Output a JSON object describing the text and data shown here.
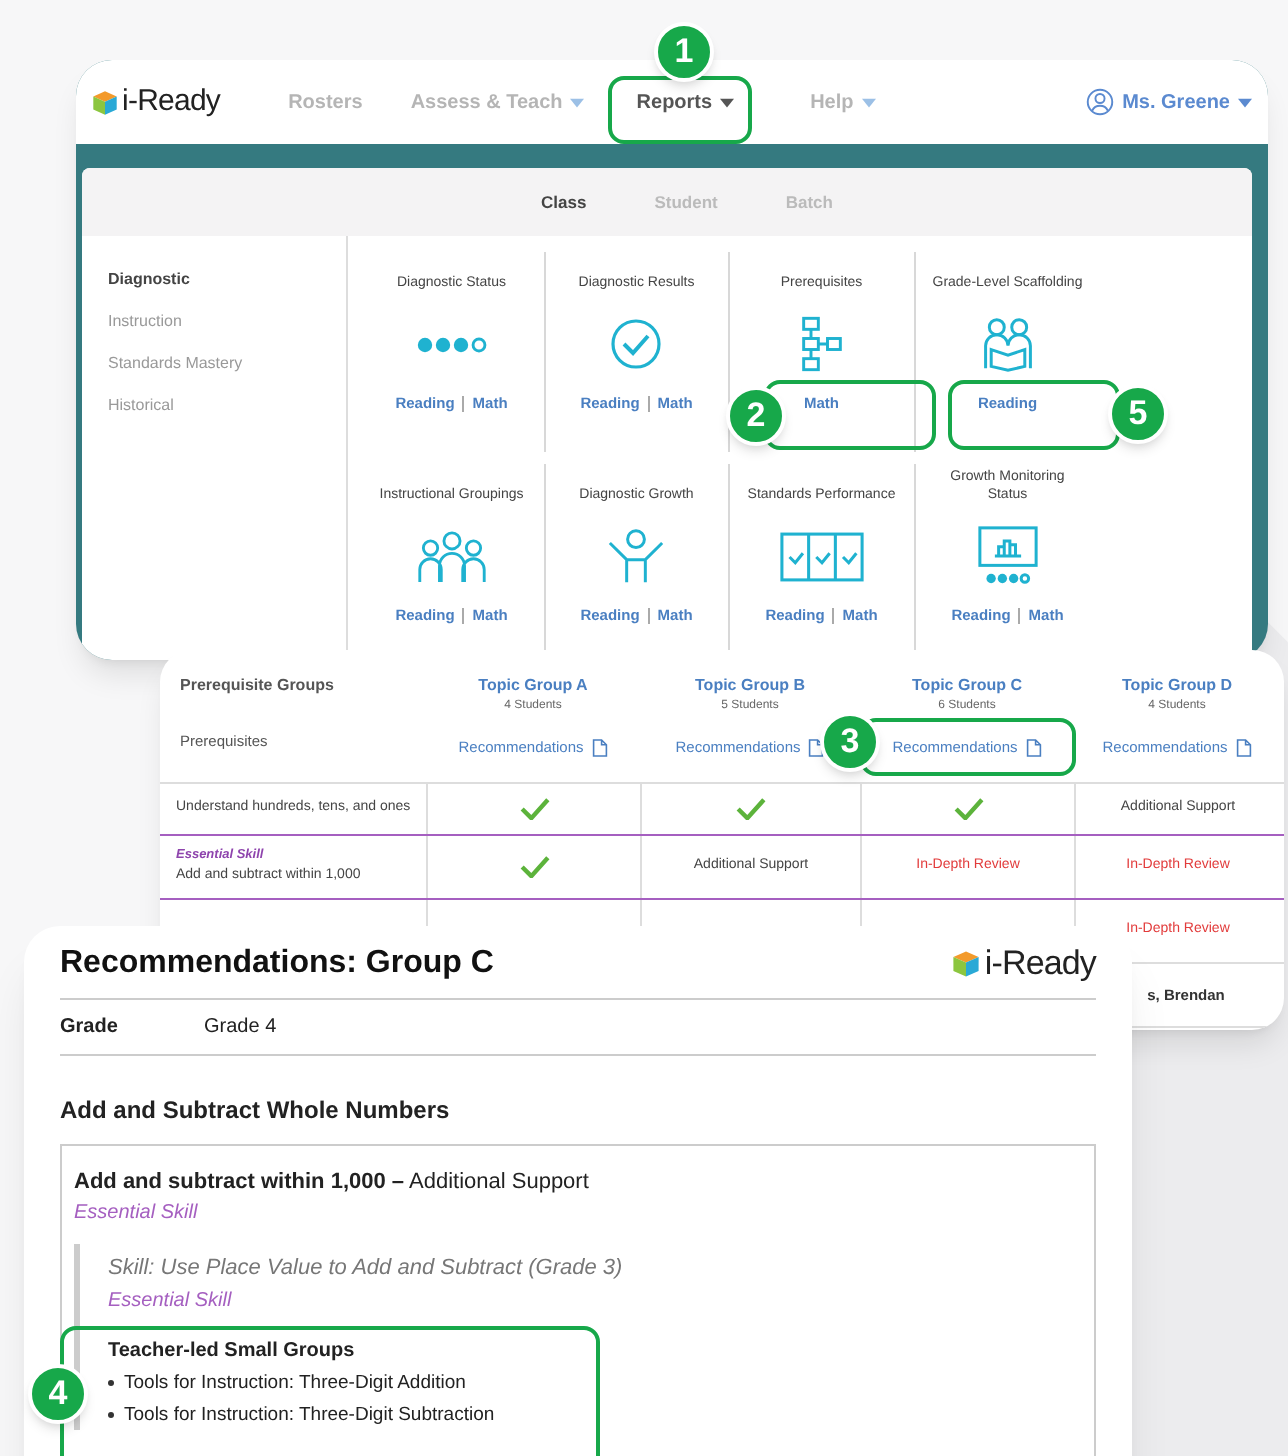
{
  "nav": {
    "logo": "i-Ready",
    "items": [
      {
        "label": "Rosters",
        "selected": false,
        "menu": false
      },
      {
        "label": "Assess & Teach",
        "selected": false,
        "menu": true
      },
      {
        "label": "Reports",
        "selected": true,
        "menu": true
      },
      {
        "label": "Help",
        "selected": false,
        "menu": true
      }
    ],
    "user": "Ms. Greene"
  },
  "report_tabs": [
    {
      "label": "Class",
      "selected": true
    },
    {
      "label": "Student",
      "selected": false
    },
    {
      "label": "Batch",
      "selected": false
    }
  ],
  "sidebar": [
    {
      "label": "Diagnostic",
      "selected": true
    },
    {
      "label": "Instruction",
      "selected": false
    },
    {
      "label": "Standards Mastery",
      "selected": false
    },
    {
      "label": "Historical",
      "selected": false
    }
  ],
  "reports": [
    {
      "title": "Diagnostic Status",
      "kind": "dots",
      "links": [
        "Reading",
        "Math"
      ]
    },
    {
      "title": "Diagnostic Results",
      "kind": "check",
      "links": [
        "Reading",
        "Math"
      ]
    },
    {
      "title": "Prerequisites",
      "kind": "flow",
      "links": [
        "Math"
      ]
    },
    {
      "title": "Grade-Level Scaffolding",
      "kind": "readers",
      "links": [
        "Reading"
      ]
    },
    {
      "title": "Instructional Groupings",
      "kind": "people",
      "links": [
        "Reading",
        "Math"
      ]
    },
    {
      "title": "Diagnostic Growth",
      "kind": "cheer",
      "links": [
        "Reading",
        "Math"
      ]
    },
    {
      "title": "Standards Performance",
      "kind": "panel",
      "links": [
        "Reading",
        "Math"
      ]
    },
    {
      "title": "Growth Monitoring Status",
      "kind": "monitor",
      "links": [
        "Reading",
        "Math"
      ]
    }
  ],
  "prerequisite_table": {
    "title": "Prerequisite Groups",
    "subtitle": "Prerequisites",
    "groups": [
      {
        "name": "Topic Group A",
        "count": "4 Students",
        "link": "Recommendations"
      },
      {
        "name": "Topic Group B",
        "count": "5 Students",
        "link": "Recommendations"
      },
      {
        "name": "Topic Group C",
        "count": "6 Students",
        "link": "Recommendations"
      },
      {
        "name": "Topic Group D",
        "count": "4 Students",
        "link": "Recommendations"
      }
    ],
    "rows": [
      {
        "label": "Understand hundreds, tens, and ones",
        "cells": [
          {
            "kind": "check"
          },
          {
            "kind": "check"
          },
          {
            "kind": "check"
          },
          {
            "kind": "support",
            "text": "Additional Support"
          }
        ]
      },
      {
        "tag": "Essential Skill",
        "label": "Add and subtract within 1,000",
        "cells": [
          {
            "kind": "check"
          },
          {
            "kind": "support",
            "text": "Additional Support"
          },
          {
            "kind": "review",
            "text": "In-Depth Review"
          },
          {
            "kind": "review",
            "text": "In-Depth Review"
          }
        ]
      },
      {
        "cells": [
          {
            "kind": "blank"
          },
          {
            "kind": "blank"
          },
          {
            "kind": "blank"
          },
          {
            "kind": "review",
            "text": "In-Depth Review"
          }
        ]
      },
      {
        "cells": [
          {
            "kind": "blank"
          },
          {
            "kind": "blank"
          },
          {
            "kind": "blank"
          },
          {
            "kind": "name",
            "text": "s, Brendan"
          }
        ]
      }
    ]
  },
  "recommendations": {
    "title": "Recommendations: Group C",
    "logo": "i-Ready",
    "grade_label": "Grade",
    "grade": "Grade 4",
    "section": "Add and Subtract Whole Numbers",
    "skill": "**Add and subtract within 1,000 –** Additional Support",
    "skill_tag": "Essential Skill",
    "subskill": "Skill: Use Place Value to Add and Subtract (Grade 3)",
    "subskill_tag": "Essential Skill",
    "activity": "Teacher-led Small Groups",
    "items": [
      "Tools for Instruction: Three-Digit Addition",
      "Tools for Instruction: Three-Digit Subtraction"
    ]
  },
  "callouts": [
    {
      "number": "1"
    },
    {
      "number": "2"
    },
    {
      "number": "3"
    },
    {
      "number": "4"
    },
    {
      "number": "5"
    }
  ]
}
